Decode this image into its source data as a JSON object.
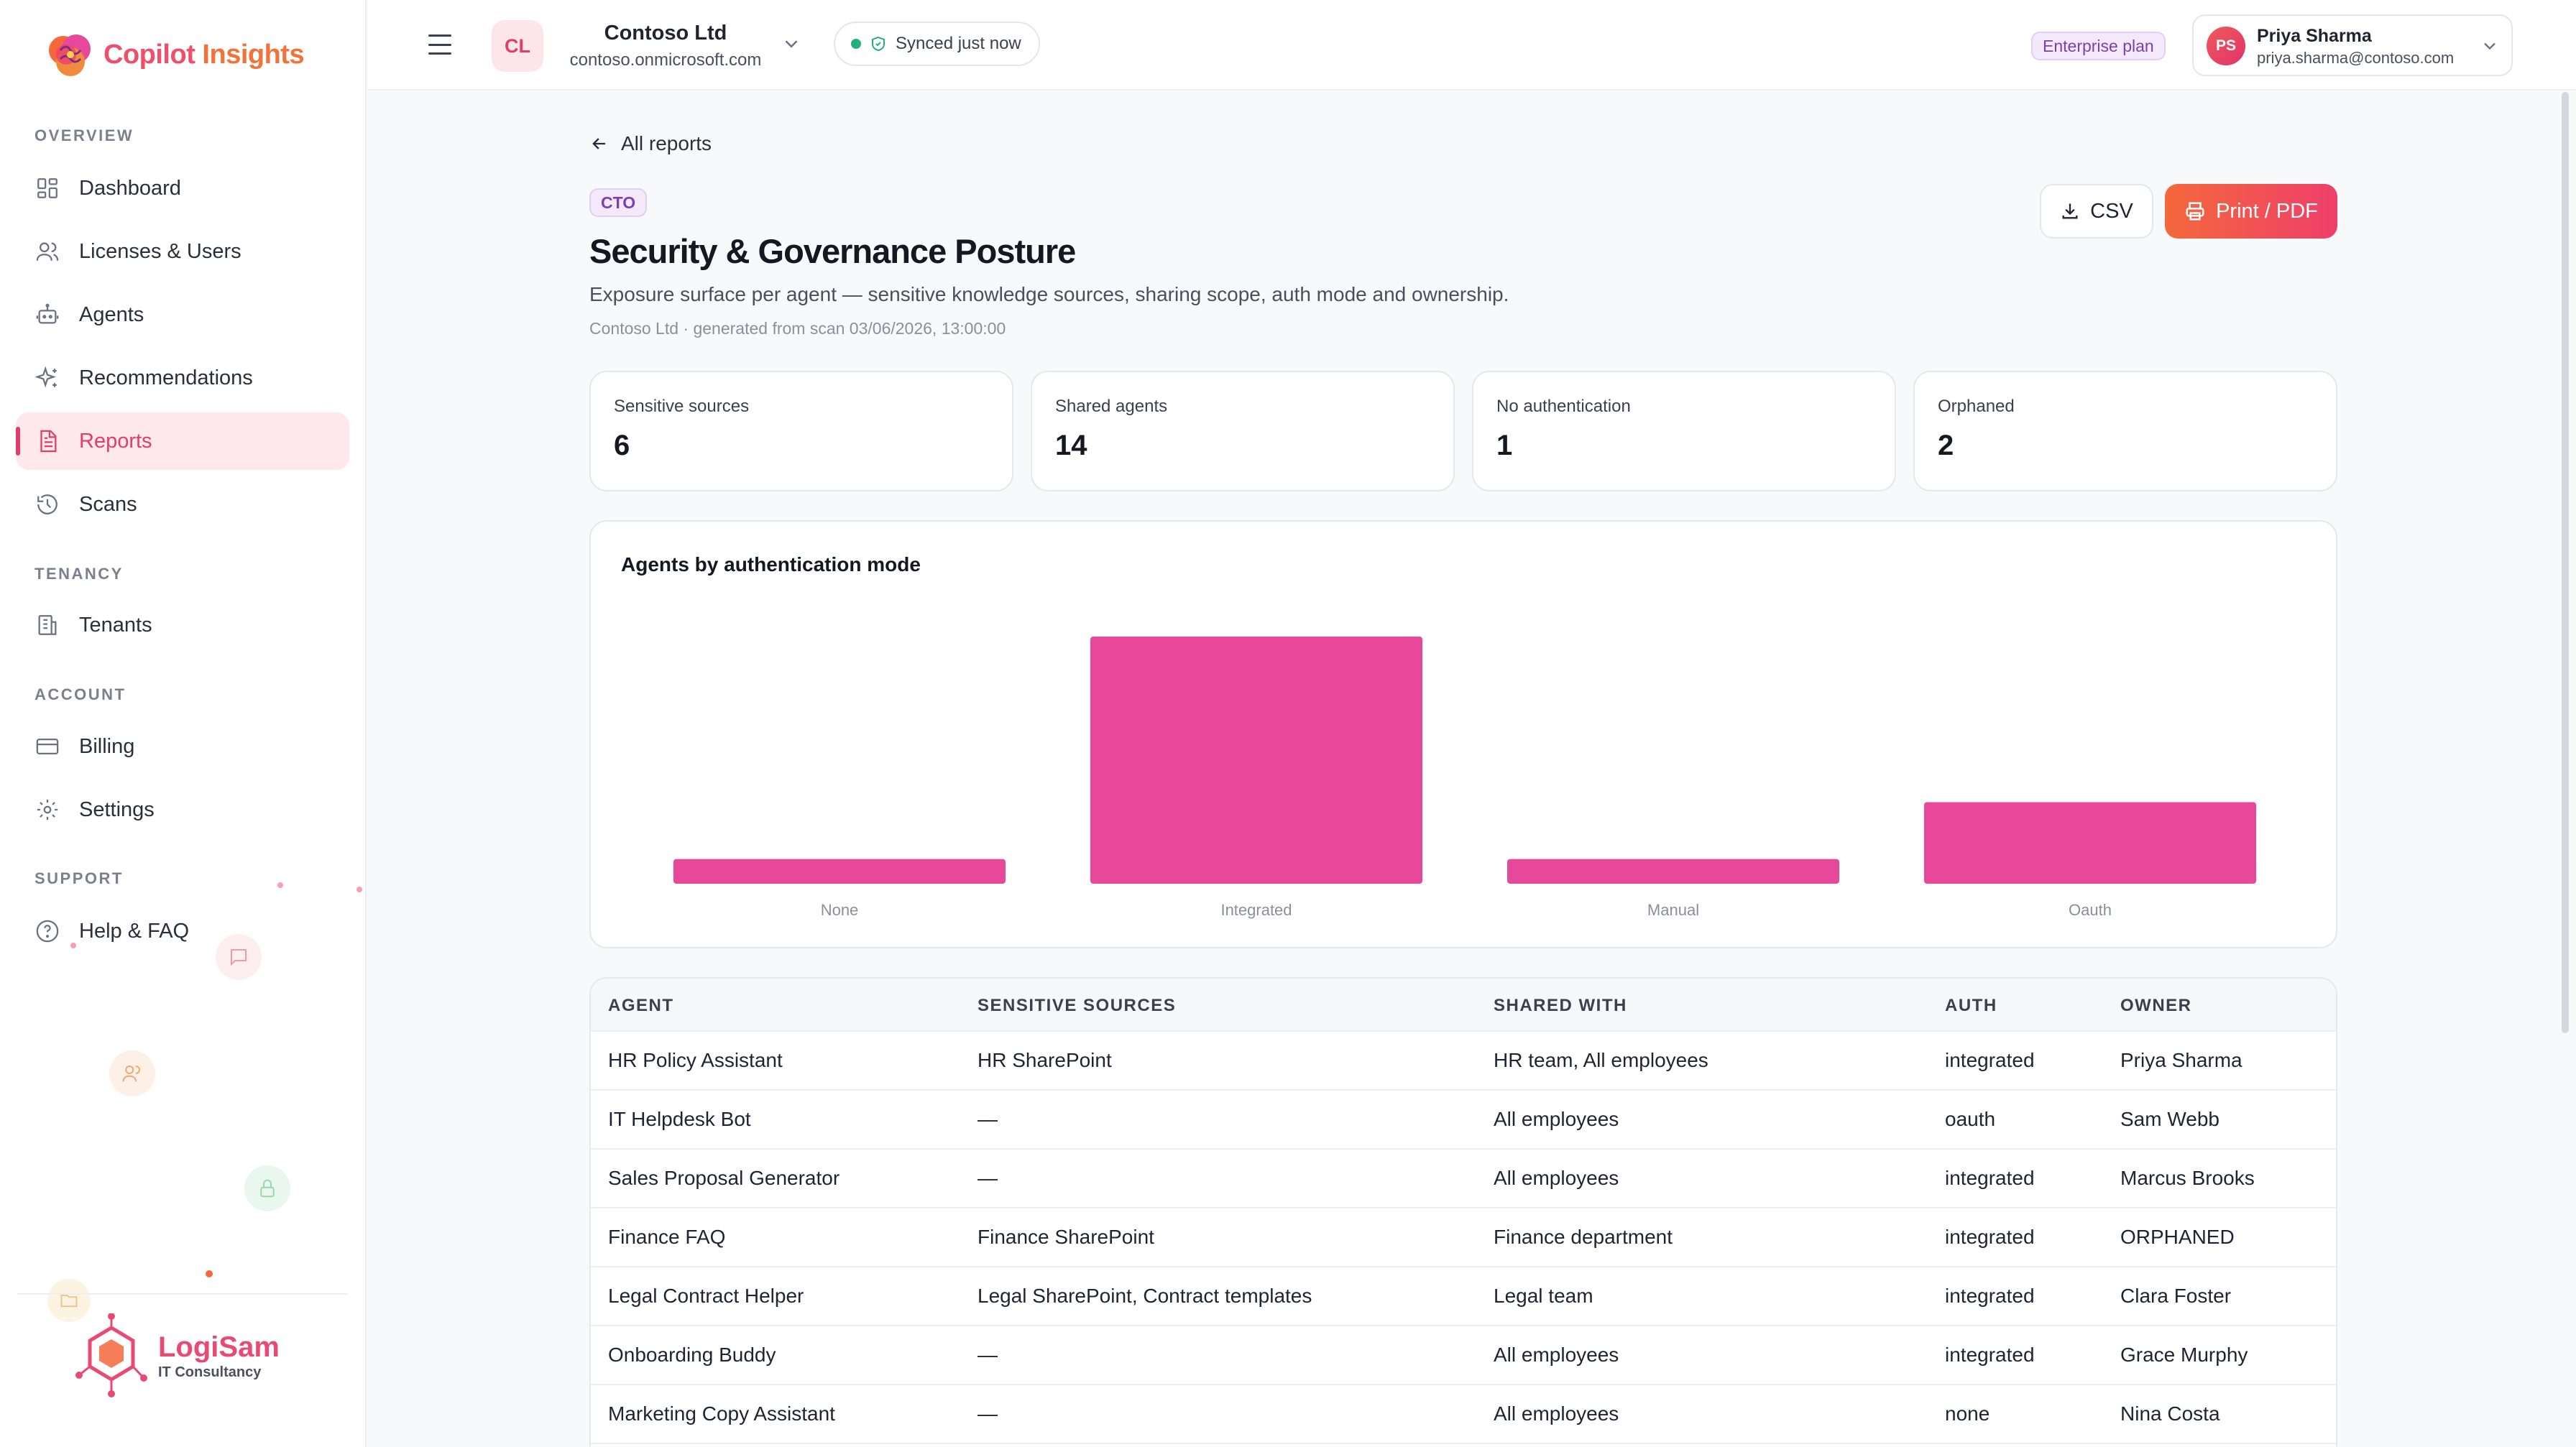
{
  "app": {
    "logo_text_1": "Copilot",
    "logo_text_2": "Insights"
  },
  "sidebar": {
    "sections": {
      "overview": "OVERVIEW",
      "tenancy": "TENANCY",
      "account": "ACCOUNT",
      "support": "SUPPORT"
    },
    "items": [
      {
        "label": "Dashboard",
        "icon": "dashboard-icon"
      },
      {
        "label": "Licenses & Users",
        "icon": "users-icon"
      },
      {
        "label": "Agents",
        "icon": "bot-icon"
      },
      {
        "label": "Recommendations",
        "icon": "sparkle-icon"
      },
      {
        "label": "Reports",
        "icon": "report-icon",
        "active": true
      },
      {
        "label": "Scans",
        "icon": "history-icon"
      },
      {
        "label": "Tenants",
        "icon": "building-icon"
      },
      {
        "label": "Billing",
        "icon": "card-icon"
      },
      {
        "label": "Settings",
        "icon": "gear-icon"
      },
      {
        "label": "Help & FAQ",
        "icon": "help-icon"
      }
    ],
    "footer_brand": {
      "name": "LogiSam",
      "sub": "IT Consultancy"
    }
  },
  "topbar": {
    "tenant_initials": "CL",
    "tenant_name": "Contoso Ltd",
    "tenant_domain": "contoso.onmicrosoft.com",
    "sync_status": "Synced just now",
    "plan": "Enterprise plan",
    "user": {
      "initials": "PS",
      "name": "Priya Sharma",
      "email": "priya.sharma@contoso.com"
    }
  },
  "page": {
    "back_label": "All reports",
    "role_tag": "CTO",
    "title": "Security & Governance Posture",
    "description": "Exposure surface per agent — sensitive knowledge sources, sharing scope, auth mode and ownership.",
    "meta": "Contoso Ltd · generated from scan 03/06/2026, 13:00:00",
    "csv_label": "CSV",
    "print_label": "Print / PDF"
  },
  "stats": [
    {
      "label": "Sensitive sources",
      "value": "6"
    },
    {
      "label": "Shared agents",
      "value": "14"
    },
    {
      "label": "No authentication",
      "value": "1"
    },
    {
      "label": "Orphaned",
      "value": "2"
    }
  ],
  "chart_data": {
    "type": "bar",
    "title": "Agents by authentication mode",
    "categories": [
      "None",
      "Integrated",
      "Manual",
      "Oauth"
    ],
    "values": [
      1,
      10,
      1,
      3.3
    ],
    "ylim": [
      0,
      10
    ],
    "grid": false,
    "legend": "none",
    "color": "#e8489a"
  },
  "table": {
    "columns": [
      "AGENT",
      "SENSITIVE SOURCES",
      "SHARED WITH",
      "AUTH",
      "OWNER"
    ],
    "rows": [
      [
        "HR Policy Assistant",
        "HR SharePoint",
        "HR team, All employees",
        "integrated",
        "Priya Sharma"
      ],
      [
        "IT Helpdesk Bot",
        "—",
        "All employees",
        "oauth",
        "Sam Webb"
      ],
      [
        "Sales Proposal Generator",
        "—",
        "All employees",
        "integrated",
        "Marcus Brooks"
      ],
      [
        "Finance FAQ",
        "Finance SharePoint",
        "Finance department",
        "integrated",
        "ORPHANED"
      ],
      [
        "Legal Contract Helper",
        "Legal SharePoint, Contract templates",
        "Legal team",
        "integrated",
        "Clara Foster"
      ],
      [
        "Onboarding Buddy",
        "—",
        "All employees",
        "integrated",
        "Grace Murphy"
      ],
      [
        "Marketing Copy Assistant",
        "—",
        "All employees",
        "none",
        "Nina Costa"
      ]
    ]
  }
}
